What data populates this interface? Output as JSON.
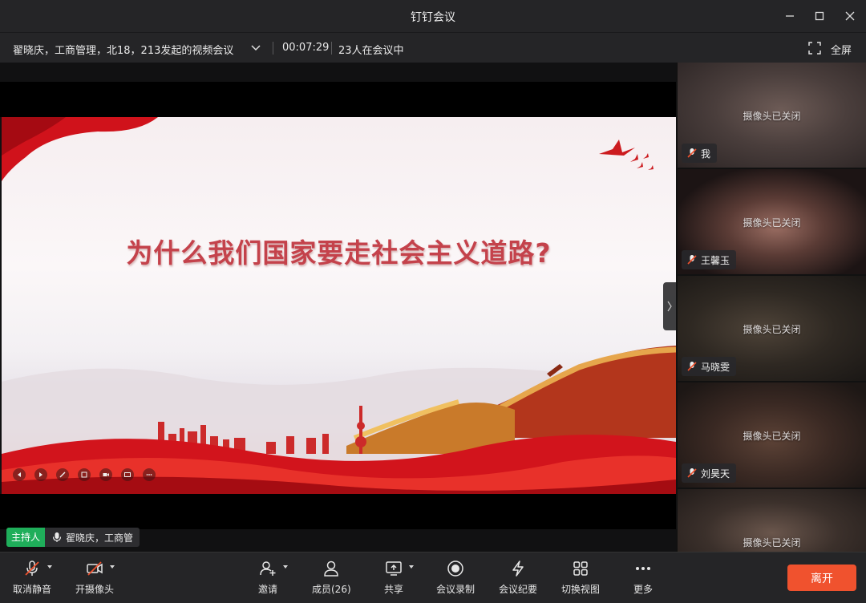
{
  "window": {
    "title": "钉钉会议"
  },
  "infobar": {
    "meeting_title": "翟晓庆，工商管理，北18，213发起的视频会议",
    "timer": "00:07:29",
    "participant_count": "23人在会议中",
    "fullscreen_label": "全屏"
  },
  "slide": {
    "title": "为什么我们国家要走社会主义道路?"
  },
  "host": {
    "badge": "主持人",
    "name": "翟晓庆，工商管"
  },
  "tiles": [
    {
      "name": "我",
      "status": "摄像头已关闭"
    },
    {
      "name": "王馨玉",
      "status": "摄像头已关闭"
    },
    {
      "name": "马晓雯",
      "status": "摄像头已关闭"
    },
    {
      "name": "刘昊天",
      "status": "摄像头已关闭"
    },
    {
      "name": "",
      "status": "摄像头已关闭"
    }
  ],
  "toolbar": {
    "unmute": "取消静音",
    "camera": "开摄像头",
    "invite": "邀请",
    "members": "成员(26)",
    "share": "共享",
    "record": "会议录制",
    "minutes": "会议纪要",
    "switch_view": "切换视图",
    "more": "更多",
    "leave": "离开"
  },
  "colors": {
    "leave_button": "#f0522e",
    "host_badge": "#1fae5a",
    "slide_title": "#c4424b"
  }
}
